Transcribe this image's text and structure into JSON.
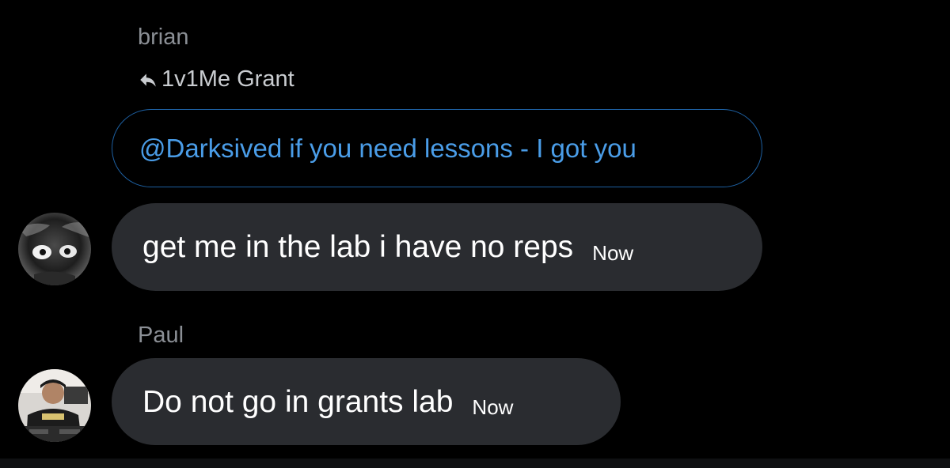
{
  "thread": {
    "group1": {
      "sender": "brian",
      "reply_to": "1v1Me Grant",
      "quoted_text": "@Darksived if you need lessons - I got you",
      "message": "get me in the lab i have no reps",
      "time": "Now",
      "avatar_icon": "avatar-dark-character"
    },
    "group2": {
      "sender": "Paul",
      "message": "Do not go in grants lab",
      "time": "Now",
      "avatar_icon": "avatar-person-photo"
    }
  },
  "colors": {
    "background": "#000000",
    "bubble": "#2a2c30",
    "quote_border": "#1d5fa0",
    "quote_text": "#4a9de8",
    "sender_name": "#8b8f95"
  }
}
